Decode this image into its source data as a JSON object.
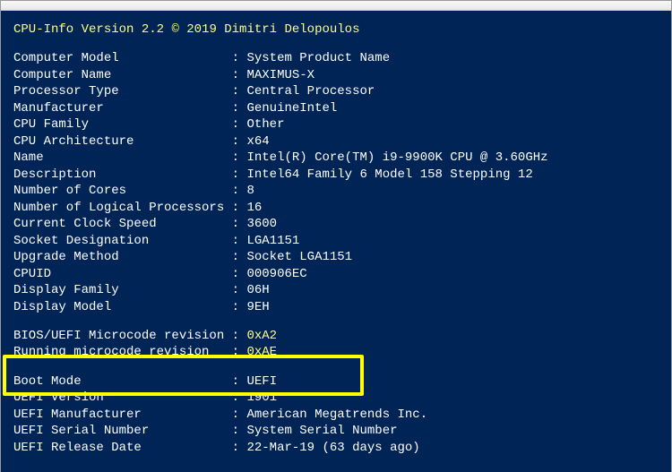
{
  "header": {
    "app": "CPU-Info Version 2.2",
    "copyright": "© 2019 Dimitri Delopoulos"
  },
  "fields": {
    "computer_model": {
      "label": "Computer Model",
      "value": "System Product Name"
    },
    "computer_name": {
      "label": "Computer Name",
      "value": "MAXIMUS-X"
    },
    "processor_type": {
      "label": "Processor Type",
      "value": "Central Processor"
    },
    "manufacturer": {
      "label": "Manufacturer",
      "value": "GenuineIntel"
    },
    "cpu_family": {
      "label": "CPU Family",
      "value": "Other"
    },
    "cpu_arch": {
      "label": "CPU Architecture",
      "value": "x64"
    },
    "name": {
      "label": "Name",
      "value": "Intel(R) Core(TM) i9-9900K CPU @ 3.60GHz"
    },
    "description": {
      "label": "Description",
      "value": "Intel64 Family 6 Model 158 Stepping 12"
    },
    "cores": {
      "label": "Number of Cores",
      "value": "8"
    },
    "logical": {
      "label": "Number of Logical Processors",
      "value": "16"
    },
    "clock": {
      "label": "Current Clock Speed",
      "value": "3600"
    },
    "socket": {
      "label": "Socket Designation",
      "value": "LGA1151"
    },
    "upgrade": {
      "label": "Upgrade Method",
      "value": "Socket LGA1151"
    },
    "cpuid": {
      "label": "CPUID",
      "value": "000906EC"
    },
    "disp_family": {
      "label": "Display Family",
      "value": "06H"
    },
    "disp_model": {
      "label": "Display Model",
      "value": "9EH"
    },
    "bios_microcode": {
      "label": "BIOS/UEFI Microcode revision",
      "value": "0xA2"
    },
    "running_microcode": {
      "label": "Running microcode revision",
      "value": "0xAE"
    },
    "boot_mode": {
      "label": "Boot Mode",
      "value": "UEFI"
    },
    "uefi_version": {
      "label": "UEFI Version",
      "value": "1901"
    },
    "uefi_mfr": {
      "label": "UEFI Manufacturer",
      "value": "American Megatrends Inc."
    },
    "uefi_serial": {
      "label": "UEFI Serial Number",
      "value": "System Serial Number"
    },
    "uefi_date": {
      "label": "UEFI Release Date",
      "value": "22-Mar-19 (63 days ago)"
    }
  }
}
